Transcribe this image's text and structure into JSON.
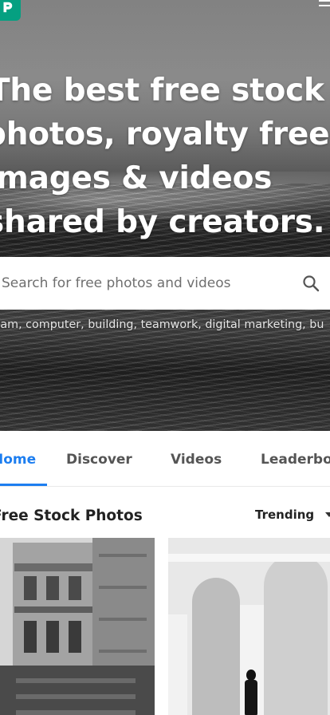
{
  "header": {
    "logo_icon": "pexels-logo-icon",
    "menu_icon": "hamburger-menu-icon",
    "brand_color": "#05a081"
  },
  "hero": {
    "headline_lines": [
      "The best free stock",
      "photos, royalty free",
      "images & videos",
      "shared by creators."
    ],
    "search": {
      "placeholder": "Search for free photos and videos",
      "icon": "search-icon"
    },
    "suggestions": "team, computer, building, teamwork, digital marketing, bu"
  },
  "tabs": [
    {
      "label": "Home",
      "active": true
    },
    {
      "label": "Discover",
      "active": false
    },
    {
      "label": "Videos",
      "active": false
    },
    {
      "label": "Leaderbo",
      "active": false
    }
  ],
  "accent_color": "#1d7ef0",
  "section": {
    "title": "Free Stock Photos",
    "sort_label": "Trending",
    "sort_icon": "chevron-down-icon"
  },
  "photos": [
    {
      "subject": "historic-building-photo"
    },
    {
      "subject": "white-arches-photo"
    }
  ]
}
